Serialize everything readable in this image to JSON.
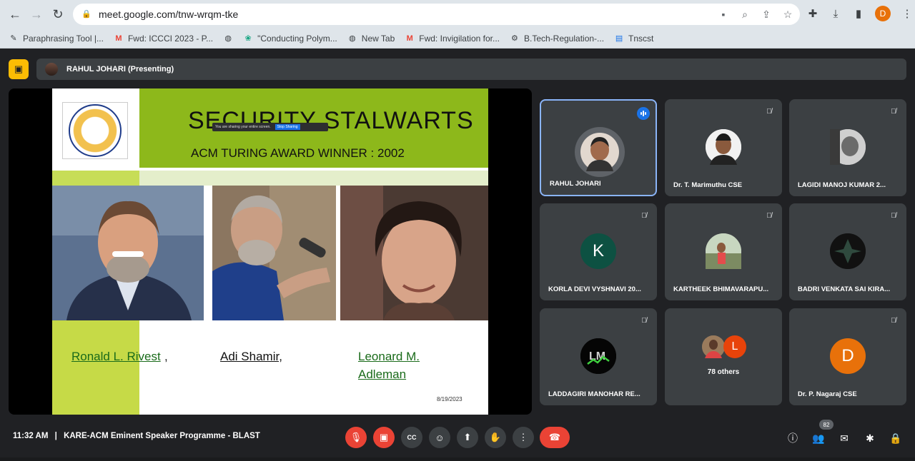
{
  "browser": {
    "url": "meet.google.com/tnw-wrqm-tke",
    "profile_initial": "D",
    "bookmarks": [
      {
        "label": "Paraphrasing Tool |...",
        "icon": "feather-icon"
      },
      {
        "label": "Fwd: ICCCI 2023 - P...",
        "icon": "gmail-icon"
      },
      {
        "label": "",
        "icon": "globe-icon"
      },
      {
        "label": "\"Conducting Polym...",
        "icon": "openai-icon"
      },
      {
        "label": "New Tab",
        "icon": "globe-icon"
      },
      {
        "label": "Fwd: Invigilation for...",
        "icon": "gmail-icon"
      },
      {
        "label": "B.Tech-Regulation-...",
        "icon": "gear-icon"
      },
      {
        "label": "Tnscst",
        "icon": "doc-icon"
      }
    ]
  },
  "presenting": {
    "label": "RAHUL JOHARI (Presenting)"
  },
  "slide": {
    "title": "SECURITY STALWARTS",
    "subtitle": "ACM TURING AWARD WINNER :   2002",
    "share_notice": "You are sharing your entire screen.",
    "share_stop": "Stop Sharing",
    "names": [
      "Ronald L. Rivest",
      ",",
      "Adi Shamir,",
      "Leonard M.",
      "Adleman"
    ],
    "date": "8/19/2023"
  },
  "participants": [
    {
      "name": "RAHUL JOHARI",
      "speaking": true
    },
    {
      "name": "Dr. T. Marimuthu CSE"
    },
    {
      "name": "LAGIDI MANOJ KUMAR 2..."
    },
    {
      "name": "KORLA DEVI VYSHNAVI 20...",
      "initial": "K",
      "color": "#0d5142"
    },
    {
      "name": "KARTHEEK BHIMAVARAPU..."
    },
    {
      "name": "BADRI VENKATA SAI KIRA..."
    },
    {
      "name": "LADDAGIRI MANOHAR RE..."
    },
    {
      "name": "78 others",
      "initial": "L",
      "color": "#e8430a"
    },
    {
      "name": "Dr. P. Nagaraj CSE",
      "initial": "D",
      "color": "#e8710a"
    }
  ],
  "meeting": {
    "time": "11:32 AM",
    "separator": "|",
    "title": "KARE-ACM Eminent Speaker Programme - BLAST",
    "people_count": "82"
  }
}
